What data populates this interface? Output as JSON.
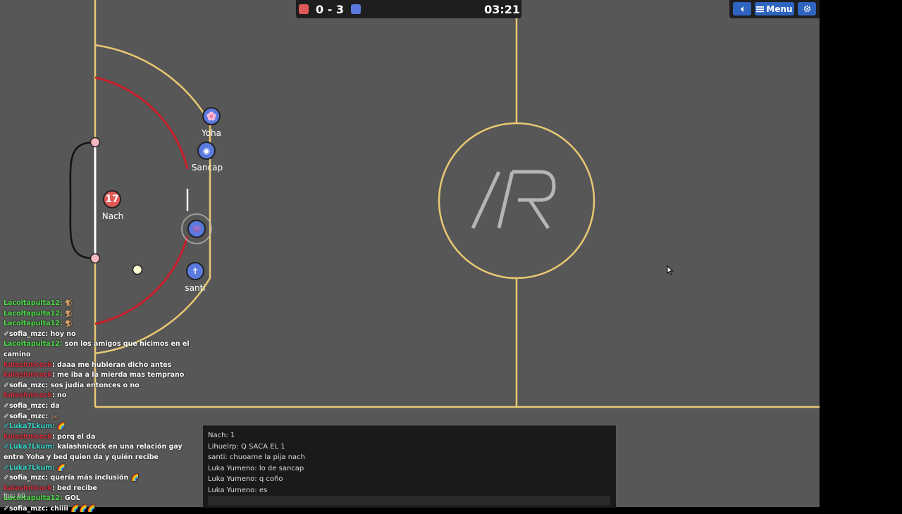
{
  "scoreboard": {
    "score_text": "0 - 3",
    "time": "03:21",
    "red_color": "#e05a57",
    "blue_color": "#5a7ae0"
  },
  "toolbar": {
    "sound_icon": "speaker-icon",
    "menu_label": "Menu",
    "settings_icon": "gear-icon"
  },
  "players": [
    {
      "name": "Yoha",
      "team": "blue",
      "avatar": "🌸"
    },
    {
      "name": "Sancap",
      "team": "blue",
      "avatar": "◉"
    },
    {
      "name": "Nach",
      "team": "red",
      "avatar": "17"
    },
    {
      "name": "",
      "team": "blue",
      "avatar": "👾"
    },
    {
      "name": "santi",
      "team": "blue",
      "avatar": "✝"
    }
  ],
  "overlay_chat": [
    {
      "user": "Lacoltapulta12:",
      "color": "green",
      "text": " 🐒"
    },
    {
      "user": "Lacoltapulta12:",
      "color": "green",
      "text": " 🐒"
    },
    {
      "user": "Lacoltapulta12:",
      "color": "green",
      "text": " 🐒"
    },
    {
      "user": "✐sofia_mzc:",
      "color": "white",
      "text": " hoy no"
    },
    {
      "user": "Lacoltapulta12:",
      "color": "green",
      "text": " son los amigos que hicimos en el camino"
    },
    {
      "user": "kalashnicock",
      "color": "red",
      "text": ": daaa me hubieran dicho antes"
    },
    {
      "user": "kalashnicock",
      "color": "red",
      "text": ": me iba a la mierda mas temprano"
    },
    {
      "user": "✐sofia_mzc:",
      "color": "white",
      "text": " sos judía entonces o no"
    },
    {
      "user": "kalashnicock",
      "color": "red",
      "text": ": no"
    },
    {
      "user": "✐sofia_mzc:",
      "color": "white",
      "text": " da"
    },
    {
      "user": "✐sofia_mzc:",
      "color": "white",
      "text": " 🦗"
    },
    {
      "user": "✐Luka7Lkum:",
      "color": "cyan",
      "text": " 🌈"
    },
    {
      "user": "kalashnicock",
      "color": "red",
      "text": ": porq el da"
    },
    {
      "user": "✐Luka7Lkum:",
      "color": "cyan",
      "text": " kalashnicock en una relación gay entre Yoha y bed quien da y quién recibe"
    },
    {
      "user": "✐Luka7Lkum:",
      "color": "cyan",
      "text": " 🌈"
    },
    {
      "user": "✐sofia_mzc:",
      "color": "white",
      "text": " quería más inclusión 🌈"
    },
    {
      "user": "kalashnicock",
      "color": "red",
      "text": ": bed recibe"
    },
    {
      "user": "Lacoltapulta12:",
      "color": "green",
      "text": " GOL"
    },
    {
      "user": "✐sofia_mzc:",
      "color": "white",
      "text": " chiiii 🌈🌈🌈"
    }
  ],
  "game_chat": [
    "Nach: 1",
    "Lihuelrp: Q SACA EL 1",
    "santi: chuoame la pija nach",
    "Luka Yumeno: lo de sancap",
    "Luka Yumeno: q coño",
    "Luka Yumeno: es"
  ],
  "fps_text": "fps: 60",
  "center_logo_text": "/R"
}
